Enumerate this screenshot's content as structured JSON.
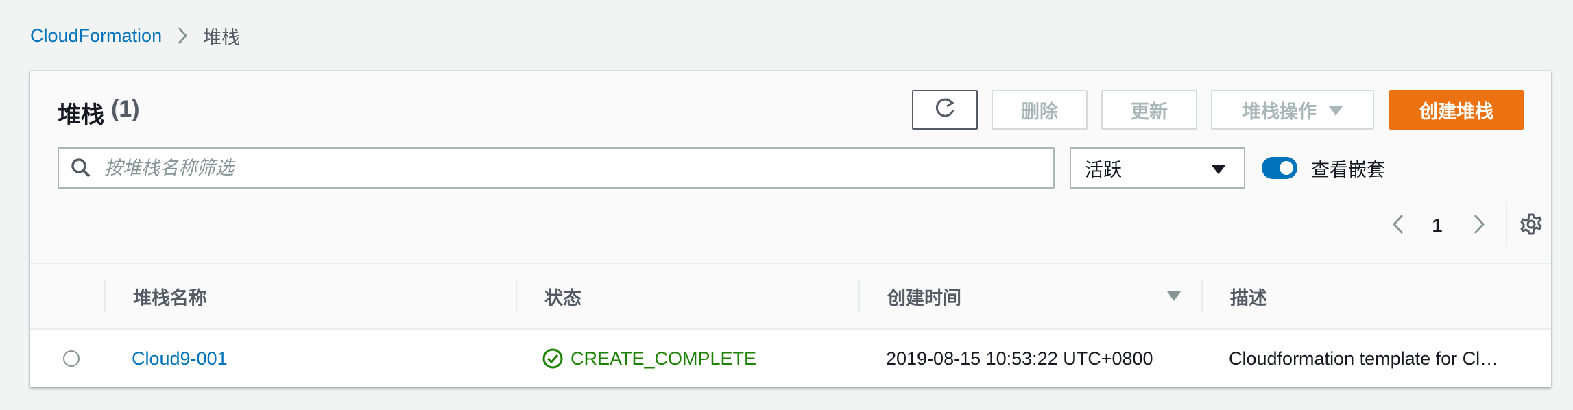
{
  "breadcrumb": {
    "root": "CloudFormation",
    "current": "堆栈"
  },
  "panel": {
    "title": "堆栈",
    "count": "(1)"
  },
  "toolbar": {
    "delete_label": "删除",
    "update_label": "更新",
    "actions_label": "堆栈操作",
    "create_label": "创建堆栈"
  },
  "filter": {
    "search_placeholder": "按堆栈名称筛选",
    "status_selected": "活跃",
    "nested_toggle_label": "查看嵌套",
    "nested_toggle_on": true
  },
  "pagination": {
    "current_page": "1"
  },
  "table": {
    "columns": [
      "堆栈名称",
      "状态",
      "创建时间",
      "描述"
    ],
    "sorted_column": "创建时间",
    "sort_direction": "descending",
    "rows": [
      {
        "name": "Cloud9-001",
        "status": "CREATE_COMPLETE",
        "created": "2019-08-15 10:53:22 UTC+0800",
        "description": "Cloudformation template for Cl…"
      }
    ]
  },
  "colors": {
    "link": "#0073bb",
    "primary_button": "#ec7211",
    "success": "#1d8102",
    "toggle_on": "#0073bb"
  },
  "icons": [
    "chevron-right-icon",
    "refresh-icon",
    "caret-down-icon",
    "search-icon",
    "chevron-left-icon",
    "gear-icon",
    "sort-descending-icon",
    "check-circle-icon"
  ]
}
